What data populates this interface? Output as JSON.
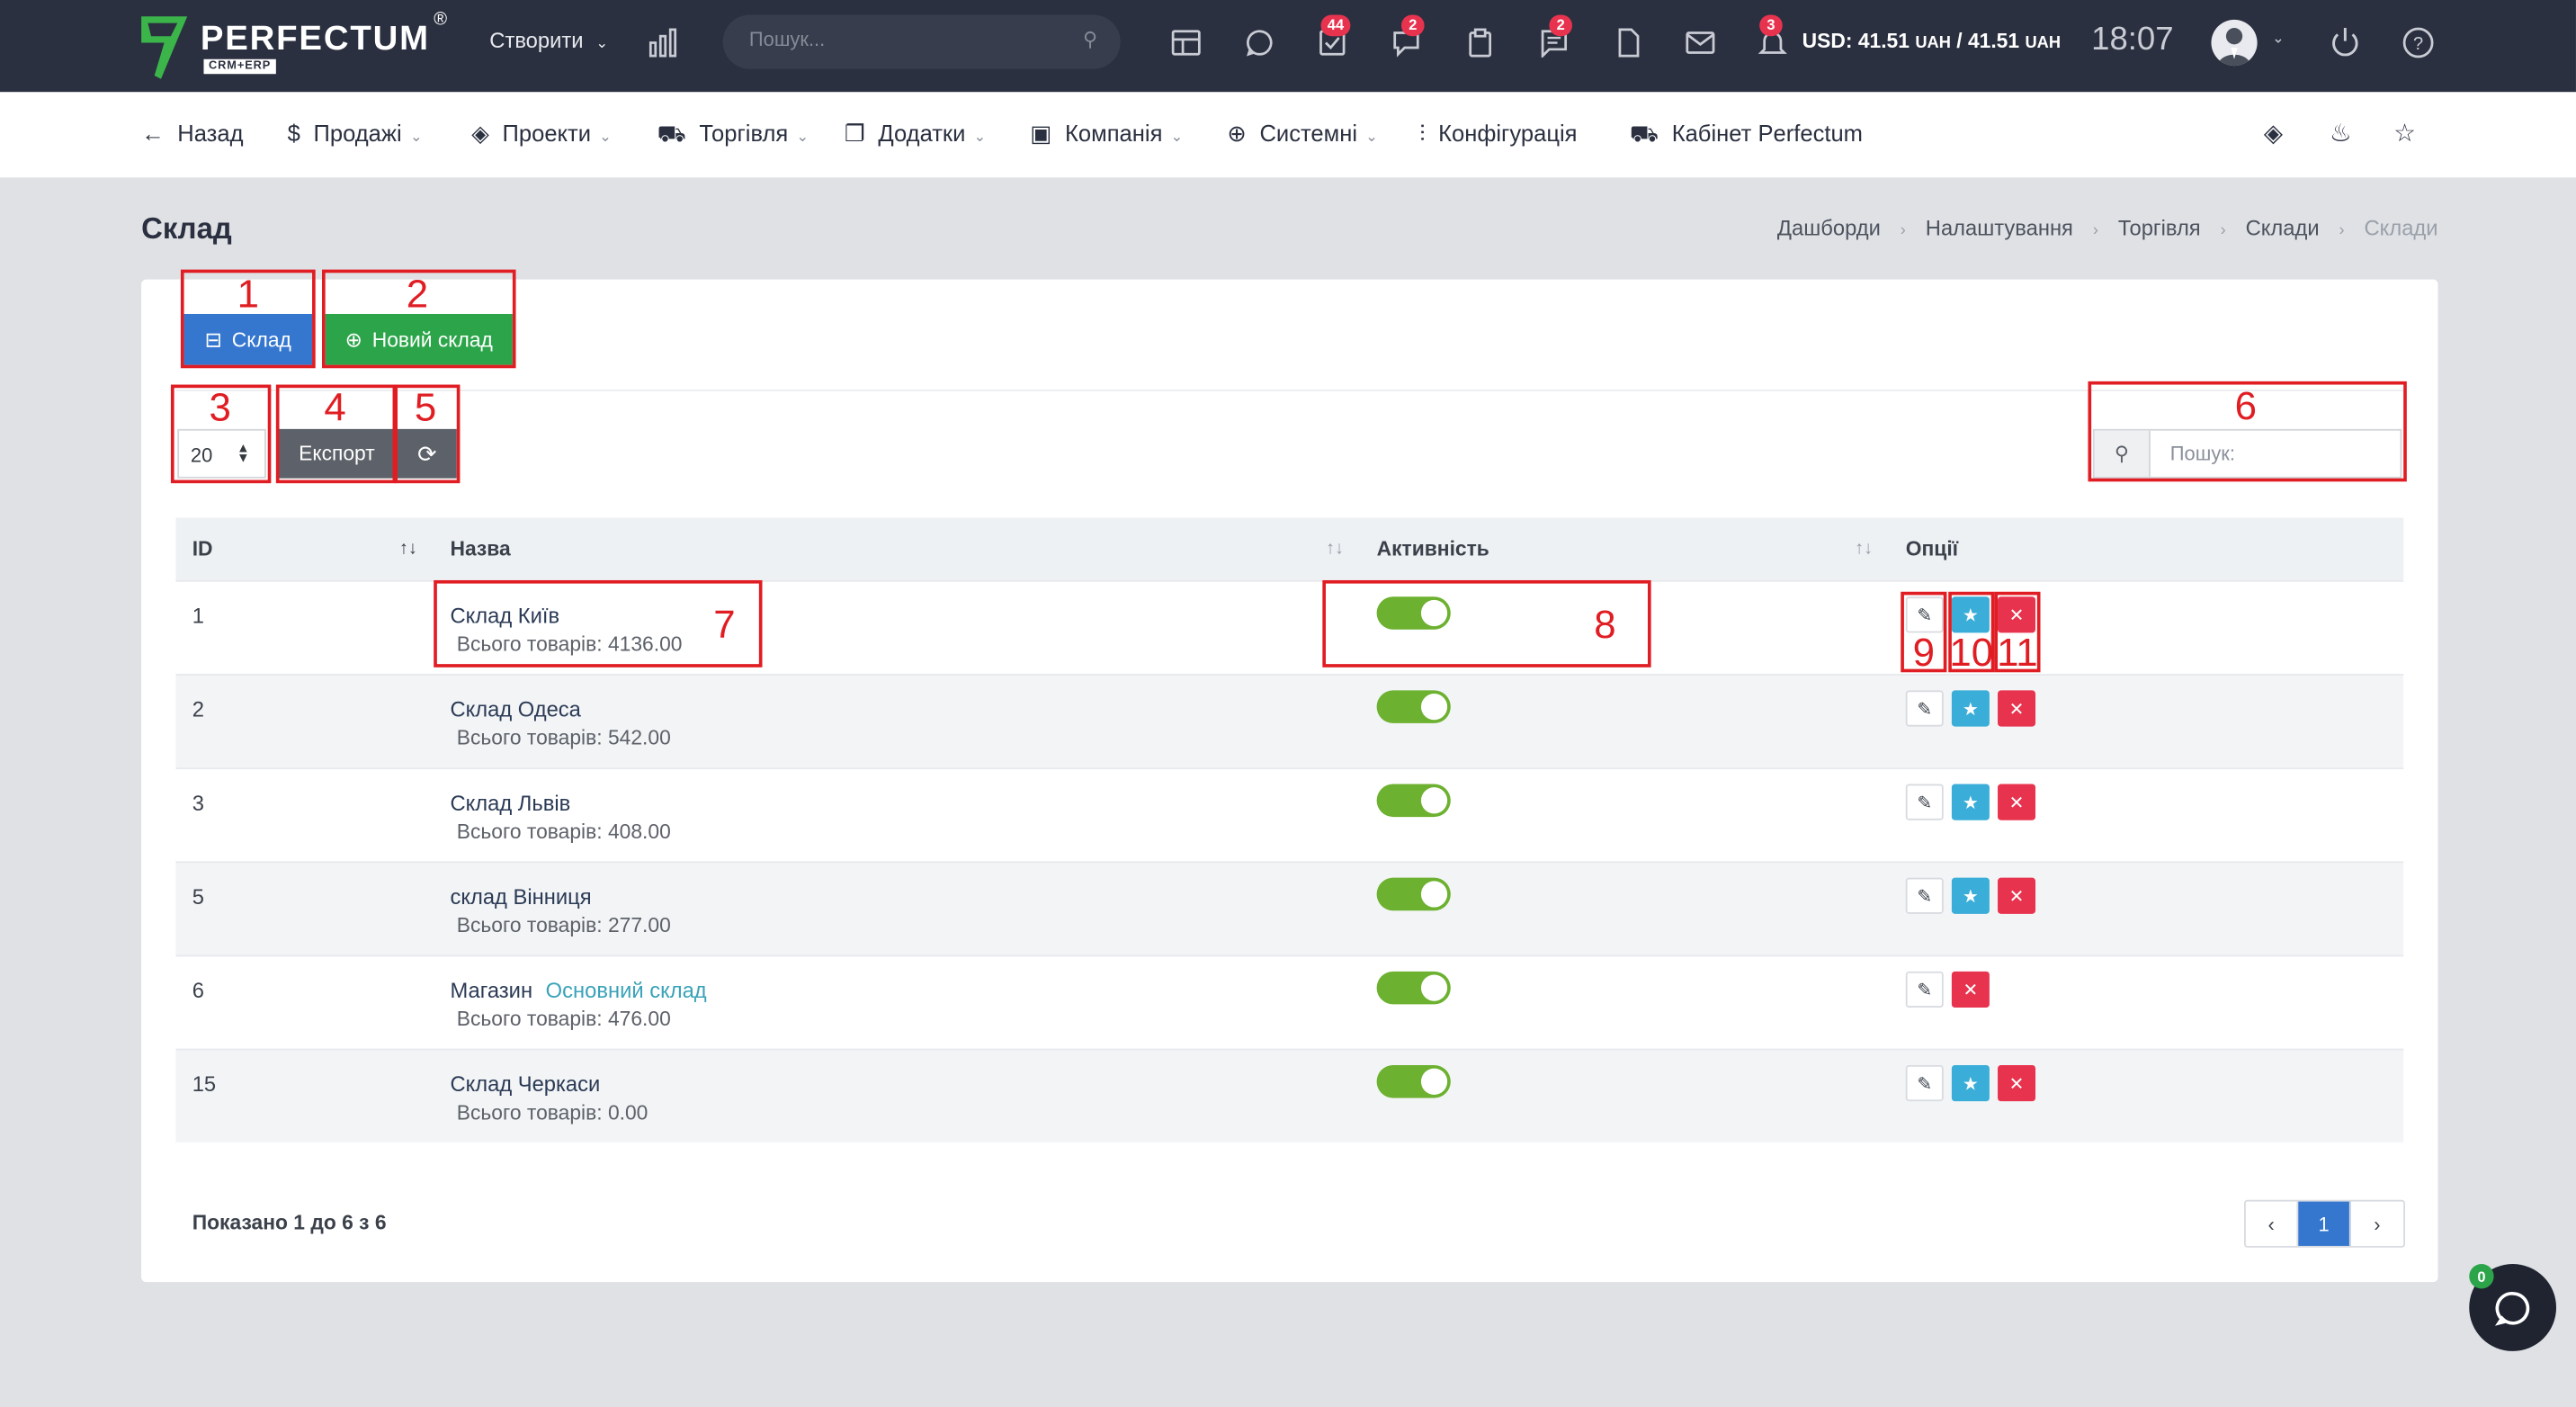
{
  "topbar": {
    "logo_text": "PERFECTUM",
    "logo_sub": "CRM+ERP",
    "create_label": "Створити",
    "search_placeholder": "Пошук...",
    "badges": {
      "tasks": "44",
      "messages": "2",
      "chat": "2",
      "notifications": "3"
    },
    "currency_prefix": "USD: 41.51",
    "currency_mid": " / 41.51",
    "currency_unit": "UAH",
    "clock": "18:07"
  },
  "nav": {
    "back": "Назад",
    "items": [
      "Продажі",
      "Проекти",
      "Торгівля",
      "Додатки",
      "Компанія",
      "Системні"
    ],
    "config": "Конфігурація",
    "cabinet": "Кабінет Perfectum"
  },
  "page": {
    "title": "Склад",
    "breadcrumb": [
      "Дашборди",
      "Налаштування",
      "Торгівля",
      "Склади",
      "Склади"
    ]
  },
  "toolbar": {
    "warehouse_btn": "Склад",
    "new_warehouse_btn": "Новий склад",
    "page_size": "20",
    "export_btn": "Експорт",
    "search_placeholder": "Пошук:"
  },
  "annotations": [
    "1",
    "2",
    "3",
    "4",
    "5",
    "6",
    "7",
    "8",
    "9",
    "10",
    "11"
  ],
  "table": {
    "columns": [
      "ID",
      "Назва",
      "Активність",
      "Опції"
    ],
    "total_prefix": "Всього товарів:",
    "main_tag": "Основний склад",
    "rows": [
      {
        "id": "1",
        "name": "Склад Київ",
        "total": "4136.00",
        "active": true,
        "main": false,
        "favorite": true
      },
      {
        "id": "2",
        "name": "Склад Одеса",
        "total": "542.00",
        "active": true,
        "main": false,
        "favorite": true
      },
      {
        "id": "3",
        "name": "Склад Львів",
        "total": "408.00",
        "active": true,
        "main": false,
        "favorite": true
      },
      {
        "id": "5",
        "name": "склад Вінниця",
        "total": "277.00",
        "active": true,
        "main": false,
        "favorite": true
      },
      {
        "id": "6",
        "name": "Магазин",
        "total": "476.00",
        "active": true,
        "main": true,
        "favorite": false
      },
      {
        "id": "15",
        "name": "Склад Черкаси",
        "total": "0.00",
        "active": true,
        "main": false,
        "favorite": true
      }
    ]
  },
  "footer": {
    "shown": "Показано 1 до 6 з 6",
    "current_page": "1"
  },
  "chat_badge": "0",
  "colors": {
    "topbar": "#2b3040",
    "primary": "#3577cf",
    "success": "#2ca54a",
    "danger": "#e8334f",
    "info": "#3aaed8",
    "annotation": "#e01d23"
  }
}
